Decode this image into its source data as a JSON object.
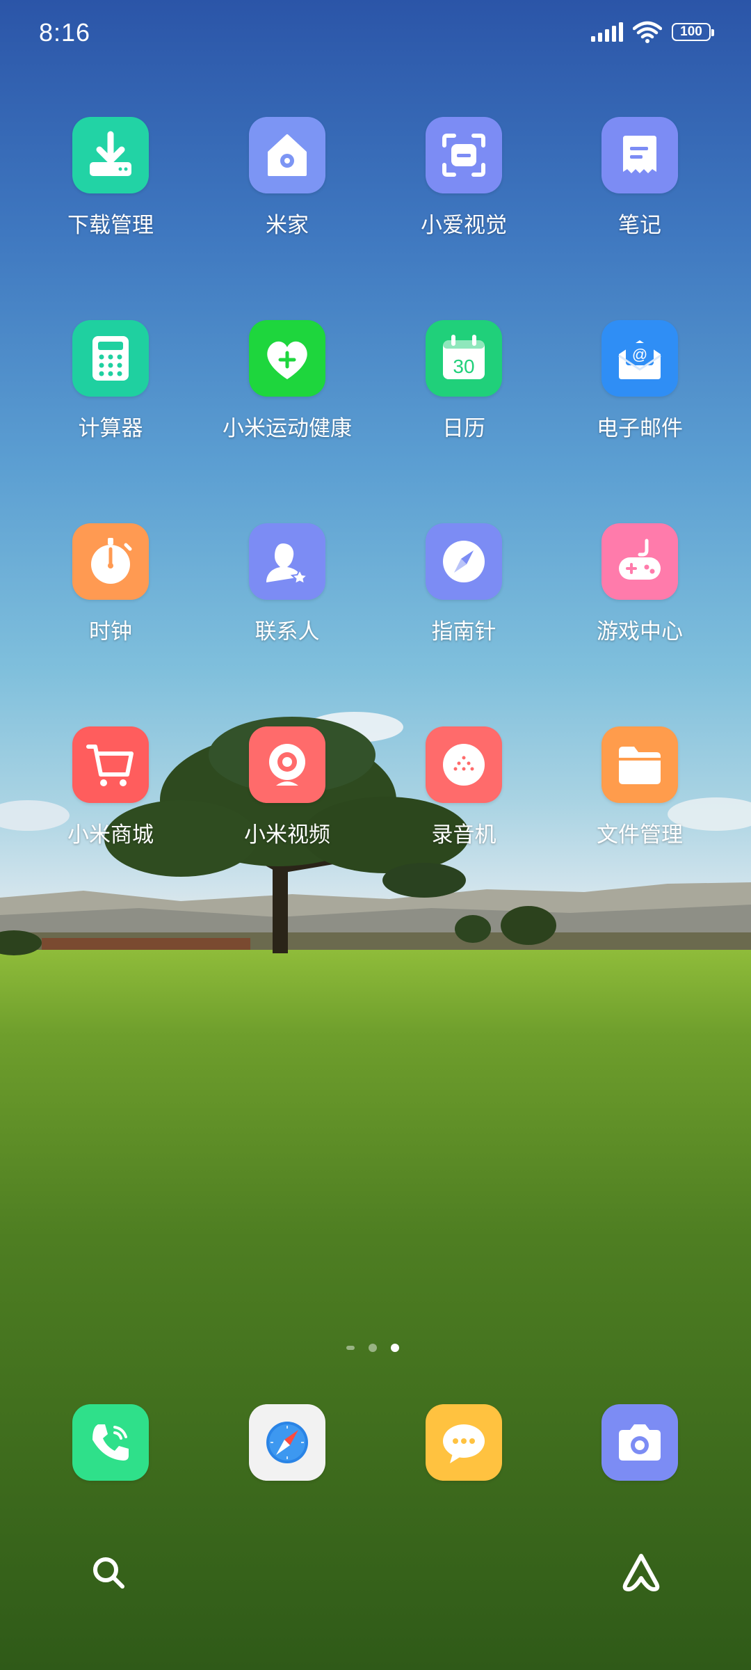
{
  "status_bar": {
    "time": "8:16",
    "battery_level": "100",
    "signal_icon": "signal-bars-icon",
    "wifi_icon": "wifi-icon"
  },
  "apps": [
    {
      "label": "下载管理",
      "icon": "download-icon",
      "color": "#22d3a5"
    },
    {
      "label": "米家",
      "icon": "home-icon",
      "color": "#7c95f4"
    },
    {
      "label": "小爱视觉",
      "icon": "scan-icon",
      "color": "#7c8cf4"
    },
    {
      "label": "笔记",
      "icon": "note-icon",
      "color": "#7c8cf4"
    },
    {
      "label": "计算器",
      "icon": "calculator-icon",
      "color": "#1fd0a0"
    },
    {
      "label": "小米运动健康",
      "icon": "heart-plus-icon",
      "color": "#1ed63d"
    },
    {
      "label": "日历",
      "icon": "calendar-icon",
      "color": "#20d07a",
      "day": "30"
    },
    {
      "label": "电子邮件",
      "icon": "mail-icon",
      "color": "#2f8ef5"
    },
    {
      "label": "时钟",
      "icon": "stopwatch-icon",
      "color": "#ff9a52"
    },
    {
      "label": "联系人",
      "icon": "contact-icon",
      "color": "#7c8cf4"
    },
    {
      "label": "指南针",
      "icon": "compass-icon",
      "color": "#7c8cf4"
    },
    {
      "label": "游戏中心",
      "icon": "gamepad-icon",
      "color": "#ff7bab"
    },
    {
      "label": "小米商城",
      "icon": "cart-icon",
      "color": "#ff5d5d"
    },
    {
      "label": "小米视频",
      "icon": "webcam-icon",
      "color": "#ff6b6b"
    },
    {
      "label": "录音机",
      "icon": "recorder-icon",
      "color": "#ff6b6b"
    },
    {
      "label": "文件管理",
      "icon": "folder-icon",
      "color": "#ff9c4c"
    }
  ],
  "page_indicator": {
    "pages": 3,
    "current": 3
  },
  "dock": [
    {
      "name": "phone-app",
      "icon": "phone-icon",
      "color": "#2fe08a"
    },
    {
      "name": "browser-app",
      "icon": "compass-browser-icon",
      "color": "#f2f2f2"
    },
    {
      "name": "messages-app",
      "icon": "message-icon",
      "color": "#ffc240"
    },
    {
      "name": "camera-app",
      "icon": "camera-icon",
      "color": "#7c8cf4"
    }
  ],
  "bottom_bar": {
    "left_icon": "search-icon",
    "right_icon": "assistant-icon"
  }
}
